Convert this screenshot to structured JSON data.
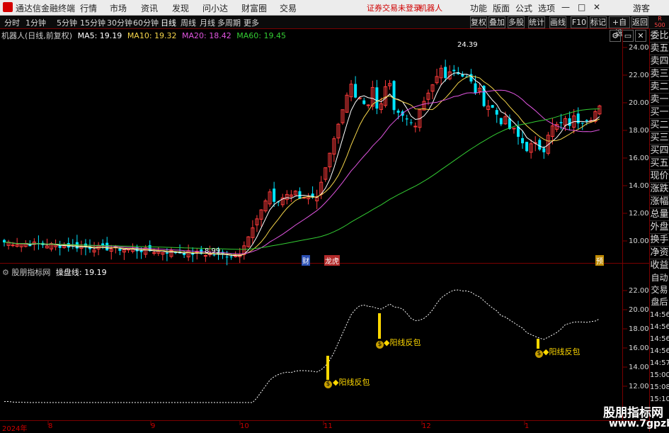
{
  "app": {
    "title": "通达信金融终端",
    "menu": [
      "行情",
      "市场",
      "资讯",
      "发现",
      "问小达",
      "财富圈",
      "交易"
    ],
    "warning": "证券交易未登录",
    "stock_name": "机器人",
    "right_menu": [
      "功能",
      "版面",
      "公式",
      "选项"
    ],
    "guest": "游客",
    "window_controls": [
      "—",
      "□",
      "✕"
    ]
  },
  "periods": [
    "分时",
    "1分钟",
    "5分钟",
    "15分钟",
    "30分钟",
    "60分钟",
    "日线",
    "周线",
    "月线",
    "多周期",
    "更多"
  ],
  "active_period": "日线",
  "toolbar_buttons": [
    "复权",
    "叠加",
    "多股",
    "统计",
    "画线",
    "F10",
    "标记",
    "+自选",
    "返回"
  ],
  "corner_badge": {
    "r": "R",
    "num": "500"
  },
  "main_legend": {
    "title": "机器人(日线,前复权)",
    "ma": [
      {
        "label": "MA5: 19.19",
        "color": "#ffffff"
      },
      {
        "label": "MA10: 19.32",
        "color": "#f5d54a"
      },
      {
        "label": "MA20: 18.42",
        "color": "#e055e0"
      },
      {
        "label": "MA60: 19.45",
        "color": "#33cc33"
      }
    ]
  },
  "price_axis": [
    "24.00",
    "22.00",
    "20.00",
    "18.00",
    "16.00",
    "14.00",
    "12.00",
    "10.00"
  ],
  "markers": {
    "high": "24.39",
    "low": "8.99"
  },
  "event_tags": [
    "财",
    "龙虎",
    "预"
  ],
  "sub_legend": {
    "name": "股朋指标网",
    "line_label": "操盘线:",
    "line_value": "19.19"
  },
  "sub_axis": [
    "22.00",
    "20.00",
    "18.00",
    "16.00",
    "14.00",
    "12.00"
  ],
  "signals": [
    "◆阳线反包",
    "◆阳线反包",
    "◆阳线反包"
  ],
  "signal_icon": "$",
  "x_axis": [
    "2024年",
    "8",
    "9",
    "10",
    "11",
    "12",
    "1"
  ],
  "side_panel": [
    "委比",
    "卖五",
    "卖四",
    "卖三",
    "卖二",
    "卖一",
    "买一",
    "买二",
    "买三",
    "买四",
    "买五",
    "现价",
    "涨跌",
    "涨幅",
    "总量",
    "外盘",
    "换手",
    "净资",
    "收益"
  ],
  "side_panel2": [
    "自动",
    "交易",
    "盘后",
    "14:56",
    "14:56",
    "14:56",
    "14:56",
    "14:57",
    "15:00",
    "15:08",
    "15:10"
  ],
  "watermark": {
    "line1": "股朋指标网",
    "line2": "www.7gpzb.com"
  },
  "colors": {
    "up": "#ff3b3b",
    "down": "#00e5ff",
    "ma5": "#ffffff",
    "ma10": "#f5d54a",
    "ma20": "#e055e0",
    "ma60": "#33cc33",
    "signal": "#ffd800"
  }
}
